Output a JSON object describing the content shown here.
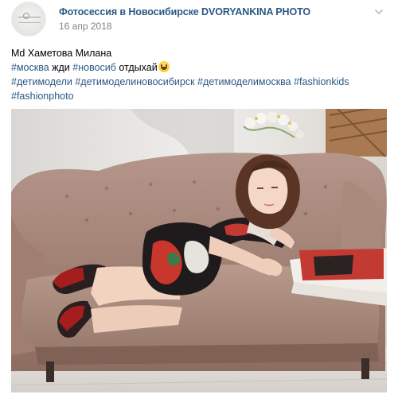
{
  "post": {
    "group_name": "Фотосессия в Новосибирске DVORYANKINA PHOTO",
    "date": "16 апр 2018",
    "menu_icon": "chevron-down-icon",
    "avatar_icon": "group-logo"
  },
  "text": {
    "line1": "Md Хаметова Милана",
    "line2": [
      {
        "text": "#москва",
        "tag": true
      },
      {
        "text": " жди ",
        "tag": false
      },
      {
        "text": "#новосиб",
        "tag": true
      },
      {
        "text": " отдыхай",
        "tag": false
      }
    ],
    "line2_emoji": "grinning-face-emoji",
    "line3": "#детимодели #детимоделиновосибирск #детимоделимосква #fashionkids",
    "line4": "#fashionphoto"
  },
  "photo": {
    "description_icon": "photo-image"
  },
  "colors": {
    "link": "#2a5885",
    "date": "#828282",
    "sofa": "#a88675",
    "background": "#ffffff"
  }
}
